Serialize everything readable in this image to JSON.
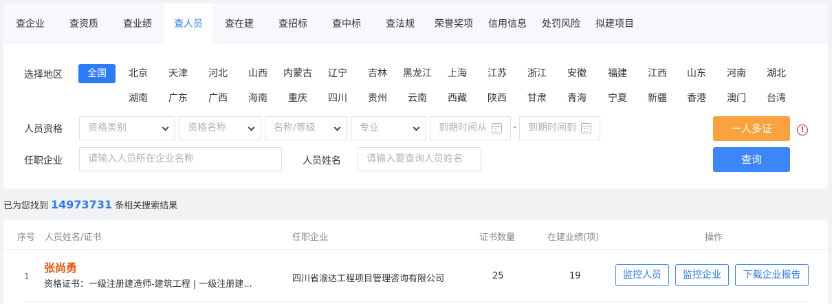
{
  "tabs": [
    "查企业",
    "查资质",
    "查业绩",
    "查人员",
    "查在建",
    "查招标",
    "查中标",
    "查法规",
    "荣誉奖项",
    "信用信息",
    "处罚风险",
    "拟建项目"
  ],
  "active_tab": "查人员",
  "region": {
    "label": "选择地区",
    "row1": [
      "全国",
      "北京",
      "天津",
      "河北",
      "山西",
      "内蒙古",
      "辽宁",
      "吉林",
      "黑龙江",
      "上海",
      "江苏",
      "浙江",
      "安徽",
      "福建",
      "江西",
      "山东",
      "河南",
      "湖北"
    ],
    "row2": [
      "湖南",
      "广东",
      "广西",
      "海南",
      "重庆",
      "四川",
      "贵州",
      "云南",
      "西藏",
      "陕西",
      "甘肃",
      "青海",
      "宁夏",
      "新疆",
      "香港",
      "澳门",
      "台湾"
    ],
    "selected": "全国"
  },
  "qualification": {
    "label": "人员资格",
    "type_placeholder": "资格类别",
    "name_placeholder": "资格名称",
    "level_placeholder": "名称/等级",
    "major_placeholder": "专业",
    "date_from_placeholder": "到期时间从",
    "date_separator": "-",
    "date_to_placeholder": "到期时间到",
    "multi_cert_button": "一人多证",
    "warning_icon": "exclamation-circle-icon"
  },
  "company_filter": {
    "label": "任职企业",
    "placeholder": "请输入人员所在企业名称"
  },
  "person_filter": {
    "label": "人员姓名",
    "placeholder": "请输入要查询人员姓名"
  },
  "search_button": "查询",
  "summary": {
    "prefix": "已为您找到",
    "count": "14973731",
    "suffix": "条相关搜索结果"
  },
  "table": {
    "headers": {
      "index": "序号",
      "name_cert": "人员姓名/证书",
      "company": "任职企业",
      "cert_count": "证书数量",
      "projects": "在建业绩(项)",
      "actions": "操作"
    },
    "rows": [
      {
        "index": "1",
        "name": "张尚勇",
        "cert": "资格证书：一级注册建造师-建筑工程 | 一级注册建...",
        "company": "四川省渝达工程项目管理咨询有限公司",
        "cert_count": "25",
        "projects": "19",
        "actions": [
          "监控人员",
          "监控企业",
          "下载企业报告"
        ]
      }
    ]
  },
  "colors": {
    "accent": "#2d7bf6",
    "orange": "#f9a23e",
    "name": "#e8570f",
    "warning": "#e2231a"
  }
}
